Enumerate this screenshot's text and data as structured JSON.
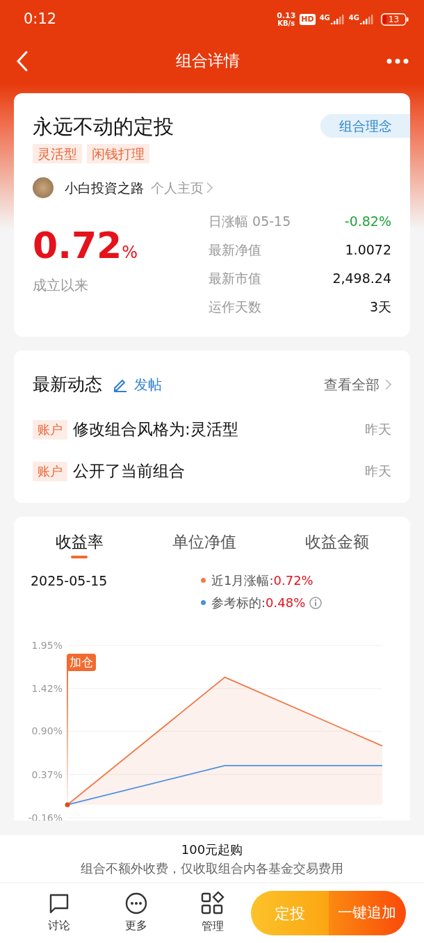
{
  "status_bar": {
    "time": "0:12",
    "speed": "0.13",
    "speed_unit": "KB/s",
    "hd": "HD",
    "networks": [
      "4G",
      "4G"
    ],
    "battery": "13"
  },
  "header": {
    "title": "组合详情"
  },
  "portfolio": {
    "name": "永远不动的定投",
    "concept_button": "组合理念",
    "tags": [
      "灵活型",
      "闲钱打理"
    ],
    "author": "小白投資之路",
    "profile_link": "个人主页",
    "return_value": "0.72",
    "return_unit": "%",
    "return_label": "成立以来",
    "stats": [
      {
        "label": "日涨幅 05-15",
        "value": "-0.82%",
        "color": "#21a336"
      },
      {
        "label": "最新净值",
        "value": "1.0072",
        "color": "#111111"
      },
      {
        "label": "最新市值",
        "value": "2,498.24",
        "color": "#111111"
      },
      {
        "label": "运作天数",
        "value": "3天",
        "color": "#111111"
      }
    ]
  },
  "news": {
    "title": "最新动态",
    "post_button": "发帖",
    "view_all": "查看全部",
    "items": [
      {
        "tag": "账户",
        "text": "修改组合风格为:灵活型",
        "time": "昨天"
      },
      {
        "tag": "账户",
        "text": "公开了当前组合",
        "time": "昨天"
      }
    ]
  },
  "performance": {
    "tabs": [
      {
        "label": "收益率",
        "selected": true
      },
      {
        "label": "单位净值",
        "selected": false
      },
      {
        "label": "收益金额",
        "selected": false
      }
    ],
    "date": "2025-05-15",
    "legend": [
      {
        "label": "近1月涨幅:",
        "value": "0.72%",
        "color": "#f07a4a"
      },
      {
        "label": "参考标的:",
        "value": "0.48%",
        "color": "#4a90e2",
        "info": true
      }
    ],
    "chart_data": {
      "type": "area",
      "grid": true,
      "ylim": [
        -0.16,
        1.95
      ],
      "yticks": [
        {
          "value": 1.95,
          "label": "1.95%"
        },
        {
          "value": 1.42,
          "label": "1.42%"
        },
        {
          "value": 0.9,
          "label": "0.90%"
        },
        {
          "value": 0.37,
          "label": "0.37%"
        },
        {
          "value": -0.16,
          "label": "-0.16%"
        }
      ],
      "series": [
        {
          "color": "#f07a4a",
          "values": [
            0,
            1.56,
            0.72
          ]
        },
        {
          "color": "#4a90e2",
          "type": "line",
          "values": [
            0,
            0.48,
            0.48
          ]
        }
      ],
      "annotations": [
        {
          "text": "加仓"
        }
      ]
    }
  },
  "purchase_info": {
    "minimum": "100元起购",
    "fee_note": "组合不额外收费，仅收取组合内各基金交易费用"
  },
  "bottom_nav": [
    {
      "label": "讨论",
      "kind": "chat"
    },
    {
      "label": "更多",
      "kind": "more"
    },
    {
      "label": "管理",
      "kind": "manage"
    }
  ],
  "actions": {
    "primary": "定投",
    "secondary": "一键追加"
  }
}
